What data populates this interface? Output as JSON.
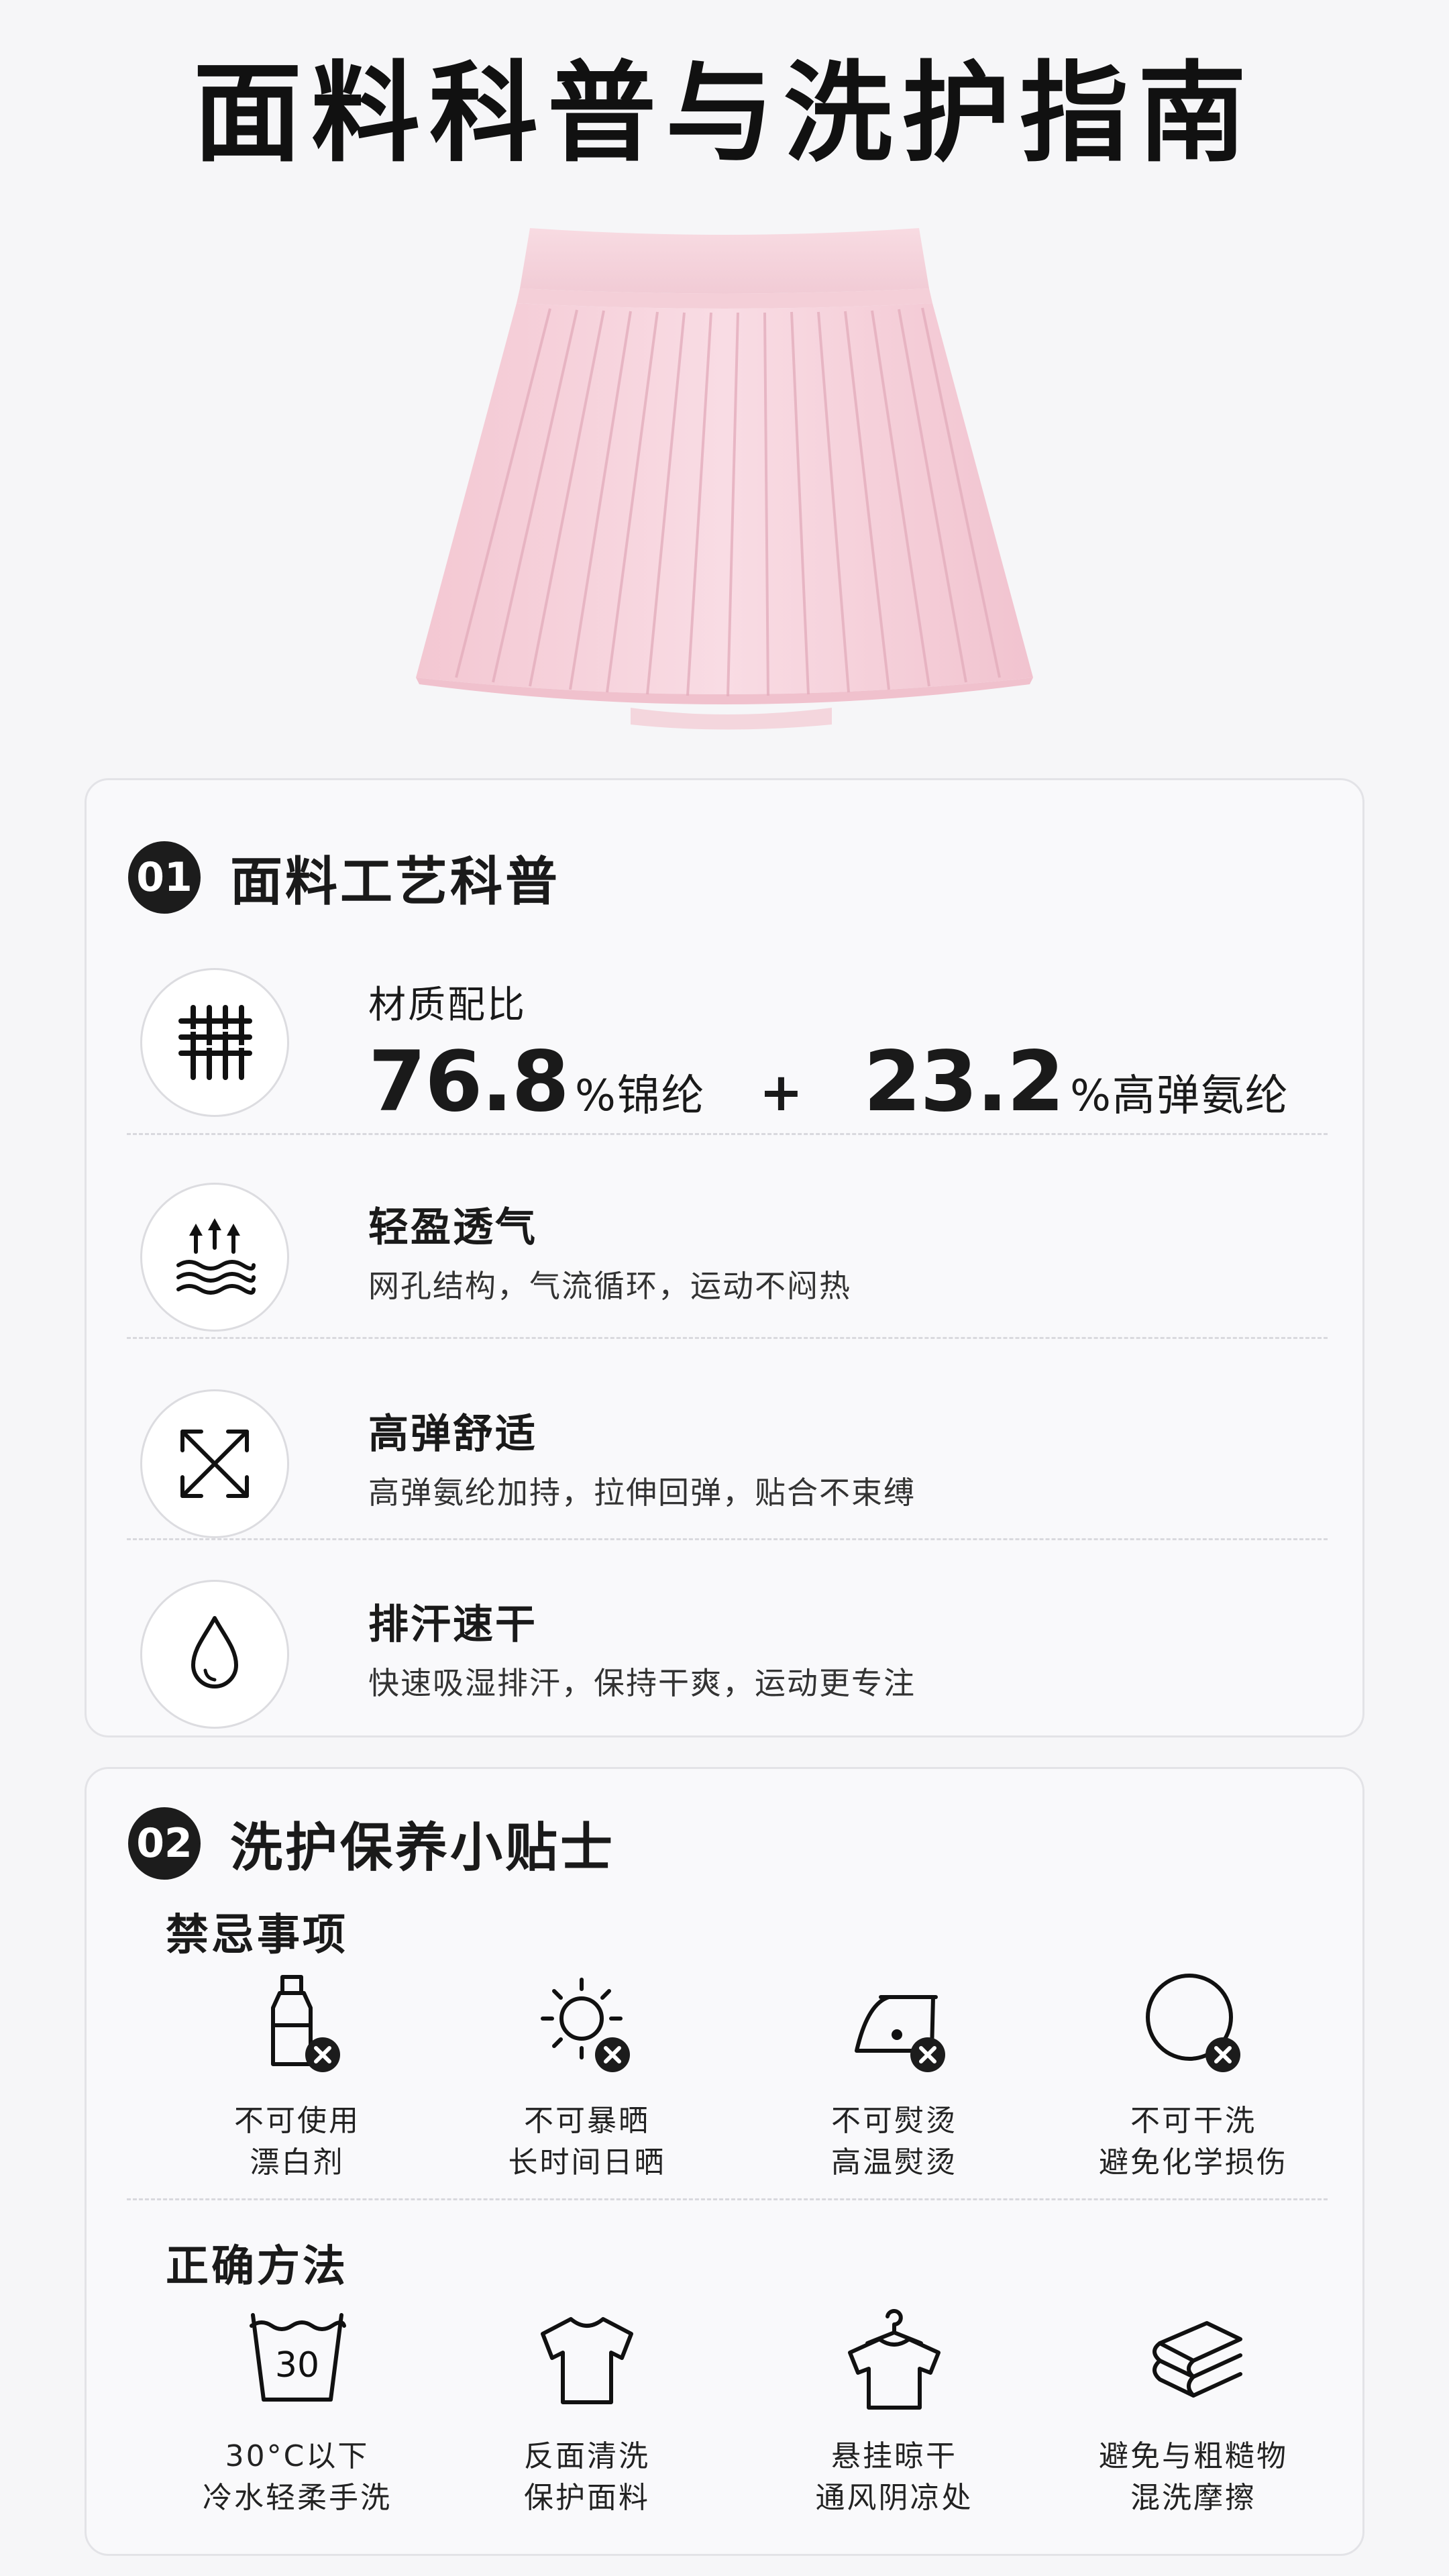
{
  "page_title": "面料科普与洗护指南",
  "section1": {
    "number": "01",
    "title": "面料工艺科普",
    "composition": {
      "label": "材质配比",
      "value1": "76.8",
      "unit1": "%锦纶",
      "plus": "+",
      "value2": "23.2",
      "unit2": "%高弹氨纶"
    },
    "features": [
      {
        "title": "轻盈透气",
        "desc": "网孔结构，气流循环，运动不闷热",
        "icon": "breathable-icon"
      },
      {
        "title": "高弹舒适",
        "desc": "高弹氨纶加持，拉伸回弹，贴合不束缚",
        "icon": "stretch-arrows-icon"
      },
      {
        "title": "排汗速干",
        "desc": "快速吸湿排汗，保持干爽，运动更专注",
        "icon": "water-drop-icon"
      }
    ]
  },
  "section2": {
    "number": "02",
    "title": "洗护保养小贴士",
    "taboo_title": "禁忌事项",
    "taboos": [
      {
        "line1": "不可使用",
        "line2": "漂白剂",
        "icon": "no-bleach-icon"
      },
      {
        "line1": "不可暴晒",
        "line2": "长时间日晒",
        "icon": "no-sun-icon"
      },
      {
        "line1": "不可熨烫",
        "line2": "高温熨烫",
        "icon": "no-iron-icon"
      },
      {
        "line1": "不可干洗",
        "line2": "避免化学损伤",
        "icon": "no-dry-clean-icon"
      }
    ],
    "method_title": "正确方法",
    "wash_temp": "30",
    "methods": [
      {
        "line1": "30°C以下",
        "line2": "冷水轻柔手洗",
        "icon": "hand-wash-30-icon"
      },
      {
        "line1": "反面清洗",
        "line2": "保护面料",
        "icon": "tshirt-icon"
      },
      {
        "line1": "悬挂晾干",
        "line2": "通风阴凉处",
        "icon": "hanger-shirt-icon"
      },
      {
        "line1": "避免与粗糙物",
        "line2": "混洗摩擦",
        "icon": "folded-towels-icon"
      }
    ]
  },
  "colors": {
    "skirt": "#f6d3dc",
    "ink": "#1c1c1c",
    "background": "#f6f6f8"
  }
}
